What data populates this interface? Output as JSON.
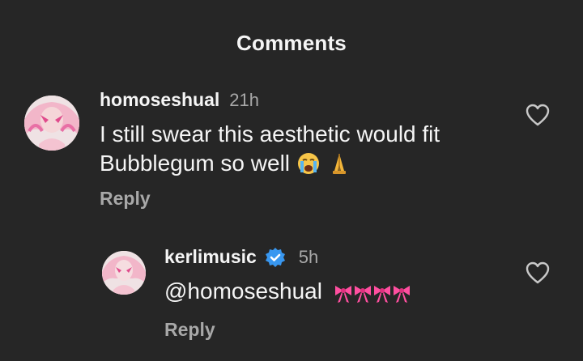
{
  "header": {
    "title": "Comments"
  },
  "comments": [
    {
      "username": "homoseshual",
      "time": "21h",
      "text_line1": "I still swear this aesthetic would fit",
      "text_line2": "Bubblegum so well",
      "emojis": [
        "crying-face",
        "folded-hands"
      ],
      "reply_label": "Reply",
      "verified": false
    },
    {
      "username": "kerlimusic",
      "time": "5h",
      "text": "@homoseshual",
      "emojis": [
        "ribbon",
        "ribbon",
        "ribbon",
        "ribbon"
      ],
      "reply_label": "Reply",
      "verified": true
    }
  ],
  "colors": {
    "background": "#262626",
    "text": "#f5f5f5",
    "muted": "#a8a8a8",
    "verified": "#3897f0",
    "ribbon": "#ff4fa0"
  }
}
